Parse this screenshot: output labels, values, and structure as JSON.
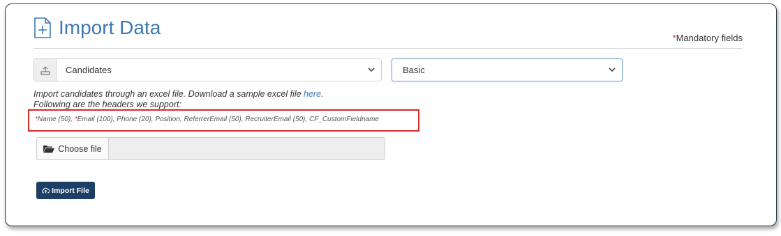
{
  "header": {
    "title": "Import Data",
    "mandatory_marker": "*",
    "mandatory_label": "Mandatory fields"
  },
  "entity_select": {
    "value": "Candidates",
    "icon": "upload-icon"
  },
  "template_select": {
    "value": "Basic"
  },
  "description": {
    "line1_prefix": "Import candidates through an excel file. Download a sample excel file ",
    "link_text": "here",
    "line1_suffix": ".",
    "line2": "Following are the headers we support:"
  },
  "supported_headers": {
    "star1": "*",
    "name": "Name (50), ",
    "star2": "*",
    "rest": "Email (100), Phone (20), Position, ReferrerEmail (50), RecruiterEmail (50), CF_CustomFieldname"
  },
  "file_input": {
    "button_label": "Choose file",
    "icon": "folder-open-icon"
  },
  "import_button": {
    "label": "Import File",
    "icon": "cloud-upload-icon"
  },
  "colors": {
    "accent": "#3d78b5",
    "button": "#1d3f66",
    "highlight": "#d9272e",
    "required": "#dd2222"
  }
}
